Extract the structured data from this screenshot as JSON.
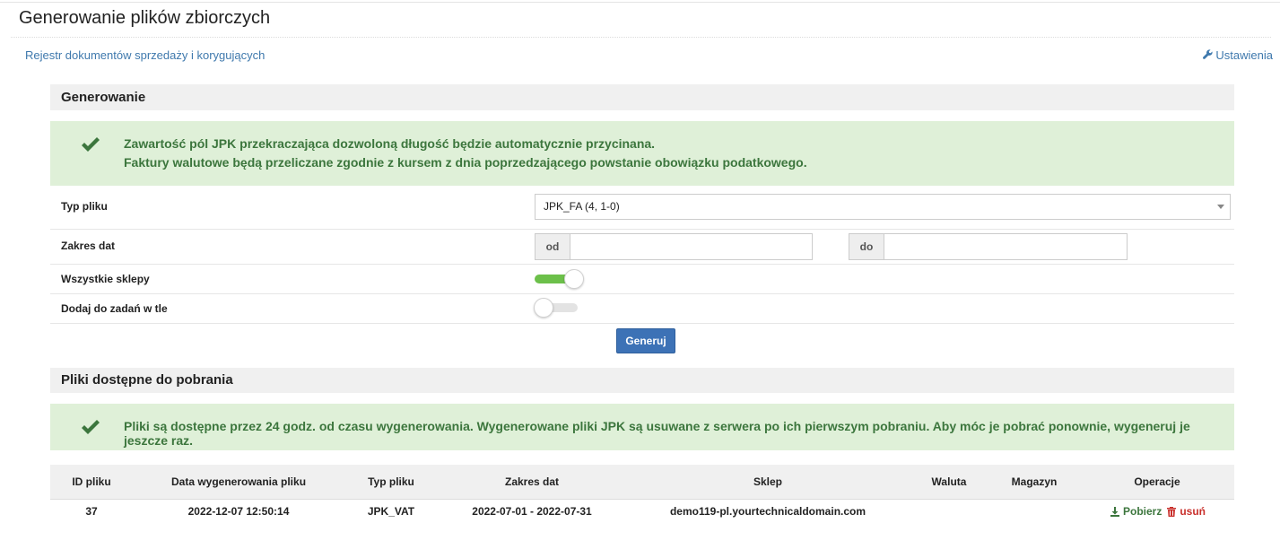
{
  "page": {
    "title": "Generowanie plików zbiorczych"
  },
  "nav": {
    "register_link": "Rejestr dokumentów sprzedaży i korygujących",
    "settings_link": "Ustawienia",
    "settings_icon": "wrench-icon"
  },
  "generate_section": {
    "header": "Generowanie",
    "alert_icon": "check-icon",
    "alert_line1": "Zawartość pól JPK przekraczająca dozwoloną długość będzie automatycznie przycinana.",
    "alert_line2": "Faktury walutowe będą przeliczane zgodnie z kursem z dnia poprzedzającego powstanie obowiązku podatkowego.",
    "file_type_label": "Typ pliku",
    "file_type_value": "JPK_FA (4, 1-0)",
    "date_range_label": "Zakres dat",
    "date_from_addon": "od",
    "date_from_value": "",
    "date_to_addon": "do",
    "date_to_value": "",
    "all_shops_label": "Wszystkie sklepy",
    "all_shops_enabled": true,
    "background_task_label": "Dodaj do zadań w tle",
    "background_task_enabled": false,
    "generate_button": "Generuj"
  },
  "files_section": {
    "header": "Pliki dostępne do pobrania",
    "alert_icon": "check-icon",
    "alert_text": "Pliki są dostępne przez 24 godz. od czasu wygenerowania. Wygenerowane pliki JPK są usuwane z serwera po ich pierwszym pobraniu. Aby móc je pobrać ponownie, wygeneruj je jeszcze raz.",
    "columns": [
      "ID pliku",
      "Data wygenerowania pliku",
      "Typ pliku",
      "Zakres dat",
      "Sklep",
      "Waluta",
      "Magazyn",
      "Operacje"
    ],
    "rows": [
      {
        "id": "37",
        "generated_at": "2022-12-07 12:50:14",
        "type": "JPK_VAT",
        "date_range": "2022-07-01 - 2022-07-31",
        "shop": "demo119-pl.yourtechnicaldomain.com",
        "currency": "",
        "warehouse": "",
        "download_label": "Pobierz",
        "delete_label": "usuń"
      }
    ]
  },
  "colors": {
    "link": "#3f79ad",
    "alert_bg": "#dff0d8",
    "alert_text": "#3c763d",
    "primary_button": "#3d72b6",
    "toggle_on": "#6cc04a",
    "delete": "#c9302c"
  }
}
